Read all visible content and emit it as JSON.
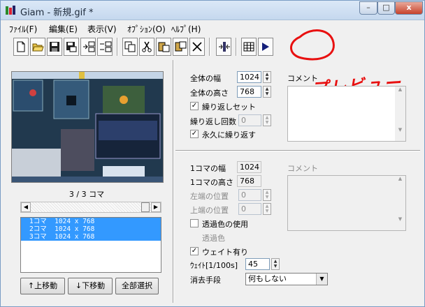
{
  "window": {
    "title": "Giam - 新規.gif *",
    "minimize": "–",
    "maximize": "□",
    "close": "x"
  },
  "menu": [
    {
      "label": "ﾌｧｲﾙ(F)"
    },
    {
      "label": "編集(E)"
    },
    {
      "label": "表示(V)"
    },
    {
      "label": "ｵﾌﾟｼｮﾝ(O)"
    },
    {
      "label": "ﾍﾙﾌﾟ(H)"
    }
  ],
  "toolbar": {
    "buttons": [
      "new-icon",
      "open-icon",
      "save-icon",
      "save-as-icon",
      "insert-frame-icon",
      "insert-frames-icon",
      "copy-icon",
      "cut-icon",
      "paste-before-icon",
      "paste-after-icon",
      "delete-icon",
      "fit-icon",
      "grid-icon",
      "play-icon"
    ]
  },
  "annotation": {
    "text": "プレビュー",
    "color": "#e81010"
  },
  "preview": {
    "frame_label": "3 / 3 コマ"
  },
  "frame_list": {
    "items": [
      "1コマ  1024 x 768",
      "2コマ  1024 x 768",
      "3コマ  1024 x 768"
    ],
    "selection_color": "#3399ff"
  },
  "buttons": {
    "move_up": "↑上移動",
    "move_down": "↓下移動",
    "select_all": "全部選択"
  },
  "global": {
    "width_label": "全体の幅",
    "width_value": "1024",
    "height_label": "全体の高さ",
    "height_value": "768",
    "loop_label": "繰り返しセット",
    "loop_checked": true,
    "loop_count_label": "繰り返し回数",
    "loop_count_value": "0",
    "forever_label": "永久に繰り返す",
    "forever_checked": true,
    "comment_label": "コメント"
  },
  "frame": {
    "width_label": "1コマの幅",
    "width_value": "1024",
    "height_label": "1コマの高さ",
    "height_value": "768",
    "left_label": "左端の位置",
    "left_value": "0",
    "top_label": "上端の位置",
    "top_value": "0",
    "transparent_label": "透過色の使用",
    "transparent_checked": false,
    "transparent_color_label": "透過色",
    "wait_label": "ウェイト有り",
    "wait_checked": true,
    "wait_time_label": "ｳｪｲﾄ[1/100s]",
    "wait_time_value": "45",
    "dispose_label": "消去手段",
    "dispose_value": "何もしない",
    "comment_label": "コメント"
  }
}
